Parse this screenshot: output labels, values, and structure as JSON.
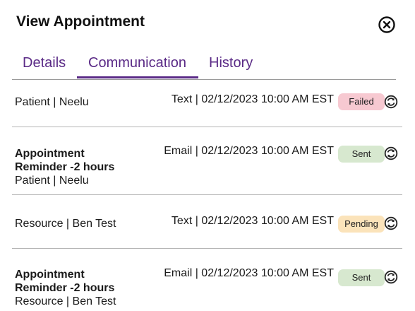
{
  "dialog": {
    "title": "View Appointment",
    "close_icon": "close-circle-icon"
  },
  "tabs": [
    {
      "label": "Details",
      "active": false
    },
    {
      "label": "Communication",
      "active": true
    },
    {
      "label": "History",
      "active": false
    }
  ],
  "colors": {
    "accent": "#5a2a86",
    "failed_bg": "#f7c9d1",
    "sent_bg": "#d7e8cf",
    "pending_bg": "#fbe3ba"
  },
  "communications": [
    {
      "subject": "",
      "recipient": "Patient | Neelu",
      "info": "Text | 02/12/2023 10:00 AM EST",
      "status": "Failed",
      "resend_icon": "resend-icon"
    },
    {
      "subject": "Appointment Reminder -2 hours",
      "recipient": "Patient | Neelu",
      "info": "Email | 02/12/2023 10:00 AM EST",
      "status": "Sent",
      "resend_icon": "resend-icon"
    },
    {
      "subject": "",
      "recipient": "Resource | Ben Test",
      "info": "Text | 02/12/2023 10:00 AM EST",
      "status": "Pending",
      "resend_icon": "resend-icon"
    },
    {
      "subject": "Appointment Reminder -2 hours",
      "recipient": "Resource | Ben Test",
      "info": "Email | 02/12/2023 10:00 AM EST",
      "status": "Sent",
      "resend_icon": "resend-icon"
    }
  ]
}
